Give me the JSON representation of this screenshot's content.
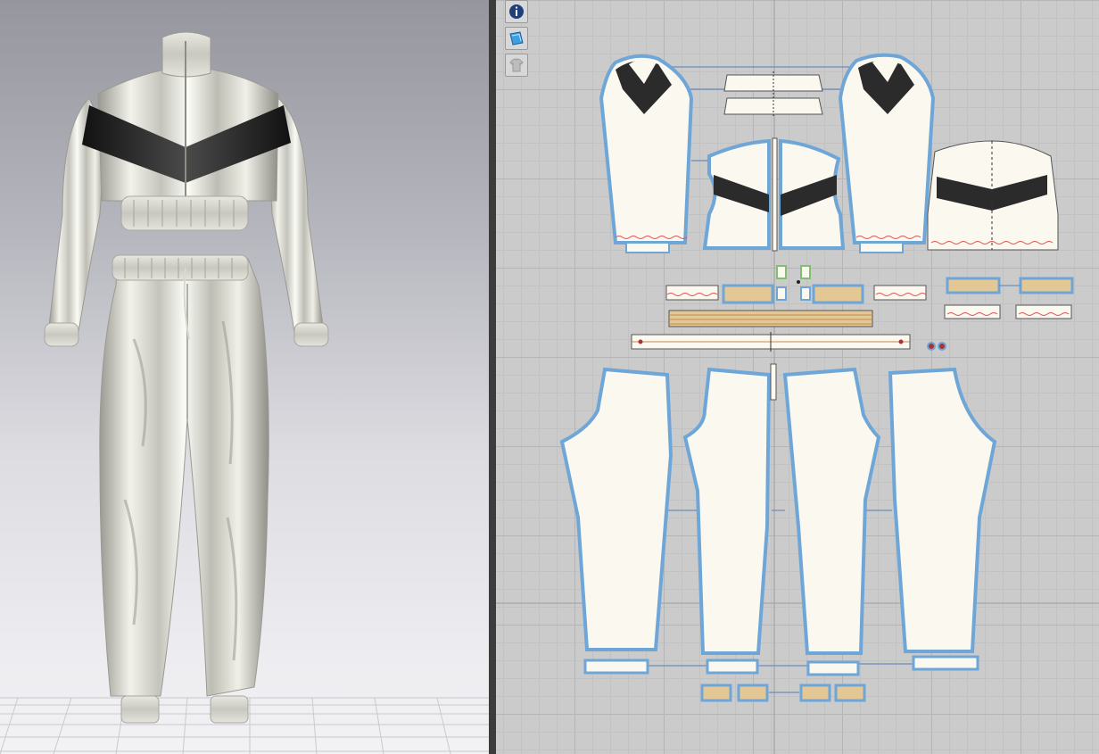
{
  "app": {
    "views": [
      "3d-avatar-view",
      "2d-pattern-view"
    ]
  },
  "toolbar": {
    "items": [
      {
        "name": "info",
        "icon": "info-icon"
      },
      {
        "name": "texture",
        "icon": "texture-icon"
      },
      {
        "name": "garment-lock",
        "icon": "garment-lock-icon"
      }
    ]
  },
  "colors": {
    "fabric_white": "#fbf8ef",
    "accent_black": "#2b2b2b",
    "band_tan": "#e3c896",
    "selection_blue": "#6fa6d8",
    "stitch_red": "#e05050",
    "viewport_bg_top": "#96969f",
    "pattern_bg": "#cbcbcb"
  }
}
